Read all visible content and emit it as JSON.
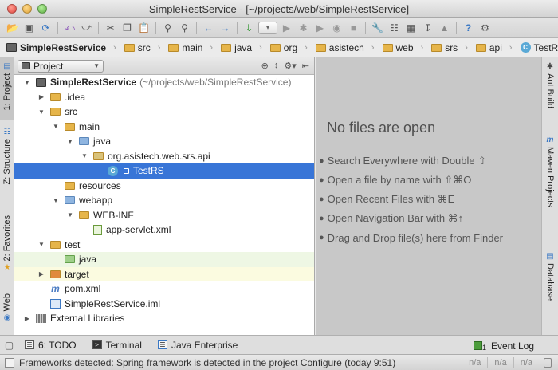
{
  "window": {
    "title": "SimpleRestService - [~/projects/web/SimpleRestService]"
  },
  "toolbar": {
    "icons": [
      "folder-open-icon",
      "save-icon",
      "sync-icon",
      "undo-icon",
      "redo-icon",
      "cut-icon",
      "copy-icon",
      "paste-icon",
      "find-icon",
      "replace-icon",
      "back-icon",
      "forward-icon",
      "make-icon",
      "run-config-dropdown",
      "run-icon",
      "debug-icon",
      "coverage-icon",
      "profile-icon",
      "attach-icon",
      "settings-icon",
      "structure-icon",
      "project-structure-icon",
      "sdk-icon",
      "android-icon",
      "help-icon",
      "tools-icon"
    ],
    "run_combo": "▾"
  },
  "breadcrumbs": [
    {
      "label": "SimpleRestService",
      "icon": "project-icon",
      "bold": true
    },
    {
      "label": "src",
      "icon": "folder-icon"
    },
    {
      "label": "main",
      "icon": "folder-icon"
    },
    {
      "label": "java",
      "icon": "folder-icon"
    },
    {
      "label": "org",
      "icon": "folder-icon"
    },
    {
      "label": "asistech",
      "icon": "folder-icon"
    },
    {
      "label": "web",
      "icon": "folder-icon"
    },
    {
      "label": "srs",
      "icon": "folder-icon"
    },
    {
      "label": "api",
      "icon": "folder-icon"
    },
    {
      "label": "TestRS",
      "icon": "class-icon"
    }
  ],
  "left_tabs": [
    {
      "label": "1: Project",
      "icon": "project-tool-icon"
    },
    {
      "label": "Z: Structure",
      "icon": "structure-tool-icon"
    },
    {
      "label": "2: Favorites",
      "icon": "star-icon"
    },
    {
      "label": "Web",
      "icon": "web-icon"
    }
  ],
  "right_tabs": [
    {
      "label": "Ant Build",
      "icon": "ant-icon"
    },
    {
      "label": "Maven Projects",
      "icon": "maven-icon"
    },
    {
      "label": "Database",
      "icon": "database-icon"
    }
  ],
  "project_panel": {
    "view_selector": "Project",
    "tree": [
      {
        "label": "SimpleRestService",
        "hint": "(~/projects/web/SimpleRestService)",
        "expanded": true,
        "icon": "project"
      },
      {
        "label": ".idea",
        "expanded": false,
        "icon": "folder"
      },
      {
        "label": "src",
        "expanded": true,
        "icon": "folder"
      },
      {
        "label": "main",
        "expanded": true,
        "icon": "folder"
      },
      {
        "label": "java",
        "expanded": true,
        "icon": "folder-blue"
      },
      {
        "label": "org.asistech.web.srs.api",
        "expanded": true,
        "icon": "package"
      },
      {
        "label": "TestRS",
        "selected": true,
        "icon": "class"
      },
      {
        "label": "resources",
        "icon": "folder-res"
      },
      {
        "label": "webapp",
        "expanded": true,
        "icon": "folder-web"
      },
      {
        "label": "WEB-INF",
        "expanded": true,
        "icon": "folder"
      },
      {
        "label": "app-servlet.xml",
        "icon": "xml"
      },
      {
        "label": "test",
        "expanded": true,
        "icon": "folder"
      },
      {
        "label": "java",
        "icon": "folder-green"
      },
      {
        "label": "target",
        "expanded": false,
        "icon": "folder-excluded"
      },
      {
        "label": "pom.xml",
        "icon": "maven"
      },
      {
        "label": "SimpleRestService.iml",
        "icon": "iml"
      },
      {
        "label": "External Libraries",
        "expanded": false,
        "icon": "library"
      }
    ]
  },
  "editor": {
    "empty_title": "No files are open",
    "hints": [
      "Search Everywhere with Double ⇧",
      "Open a file by name with ⇧⌘O",
      "Open Recent Files with ⌘E",
      "Open Navigation Bar with ⌘↑",
      "Drag and Drop file(s) here from Finder"
    ]
  },
  "bottom_tabs": [
    {
      "label": "6: TODO",
      "icon": "todo-icon"
    },
    {
      "label": "Terminal",
      "icon": "terminal-icon"
    },
    {
      "label": "Java Enterprise",
      "icon": "java-ee-icon"
    }
  ],
  "event_log": {
    "label": "Event Log",
    "count": "1"
  },
  "status": {
    "message": "Frameworks detected: Spring framework is detected in the project Configure (today 9:51)",
    "cells": [
      "n/a",
      "n/a",
      "n/a"
    ]
  }
}
